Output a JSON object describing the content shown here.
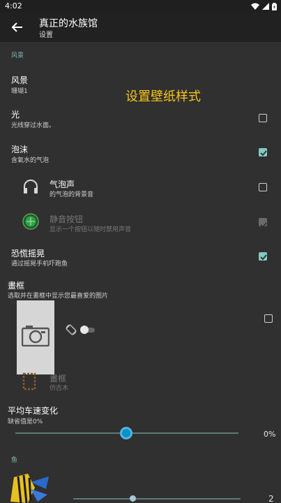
{
  "status_bar": {
    "time": "4:02"
  },
  "app_bar": {
    "title": "真正的水族馆",
    "subtitle": "设置"
  },
  "annotation": "设置壁纸样式",
  "sections": {
    "scenery_header": "风景",
    "fish_header": "鱼"
  },
  "prefs": {
    "scenery": {
      "title": "风景",
      "summary": "珊瑚1"
    },
    "light": {
      "title": "光",
      "summary": "光线穿过水面。",
      "checked": false
    },
    "bubbles": {
      "title": "泡沫",
      "summary": "含氧水的气泡",
      "checked": true
    },
    "bubble_sound": {
      "title": "气泡声",
      "summary": "的气泡的背景音",
      "checked": false
    },
    "mute_button": {
      "title": "静音按钮",
      "summary": "显示一个按钮以随时禁用声音",
      "checked": true,
      "enabled": false
    },
    "panic_shake": {
      "title": "恐慌摇晃",
      "summary": "通过摇晃手机吓跑鱼",
      "checked": true
    },
    "frame": {
      "title": "畫框",
      "summary": "选取并在畫框中显示您最喜爱的图片",
      "checked": false
    },
    "frame_style": {
      "title": "畫框",
      "summary": "仿古木"
    },
    "avg_speed": {
      "title": "平均车速变化",
      "summary": "缺省值是0%",
      "value_label": "0%",
      "value": 0
    },
    "fish_count": {
      "value_label": "2",
      "value": 2
    }
  },
  "colors": {
    "accent": "#80cbc4",
    "slider_thumb": "#0b8fc6",
    "annotation": "#f5c518"
  }
}
